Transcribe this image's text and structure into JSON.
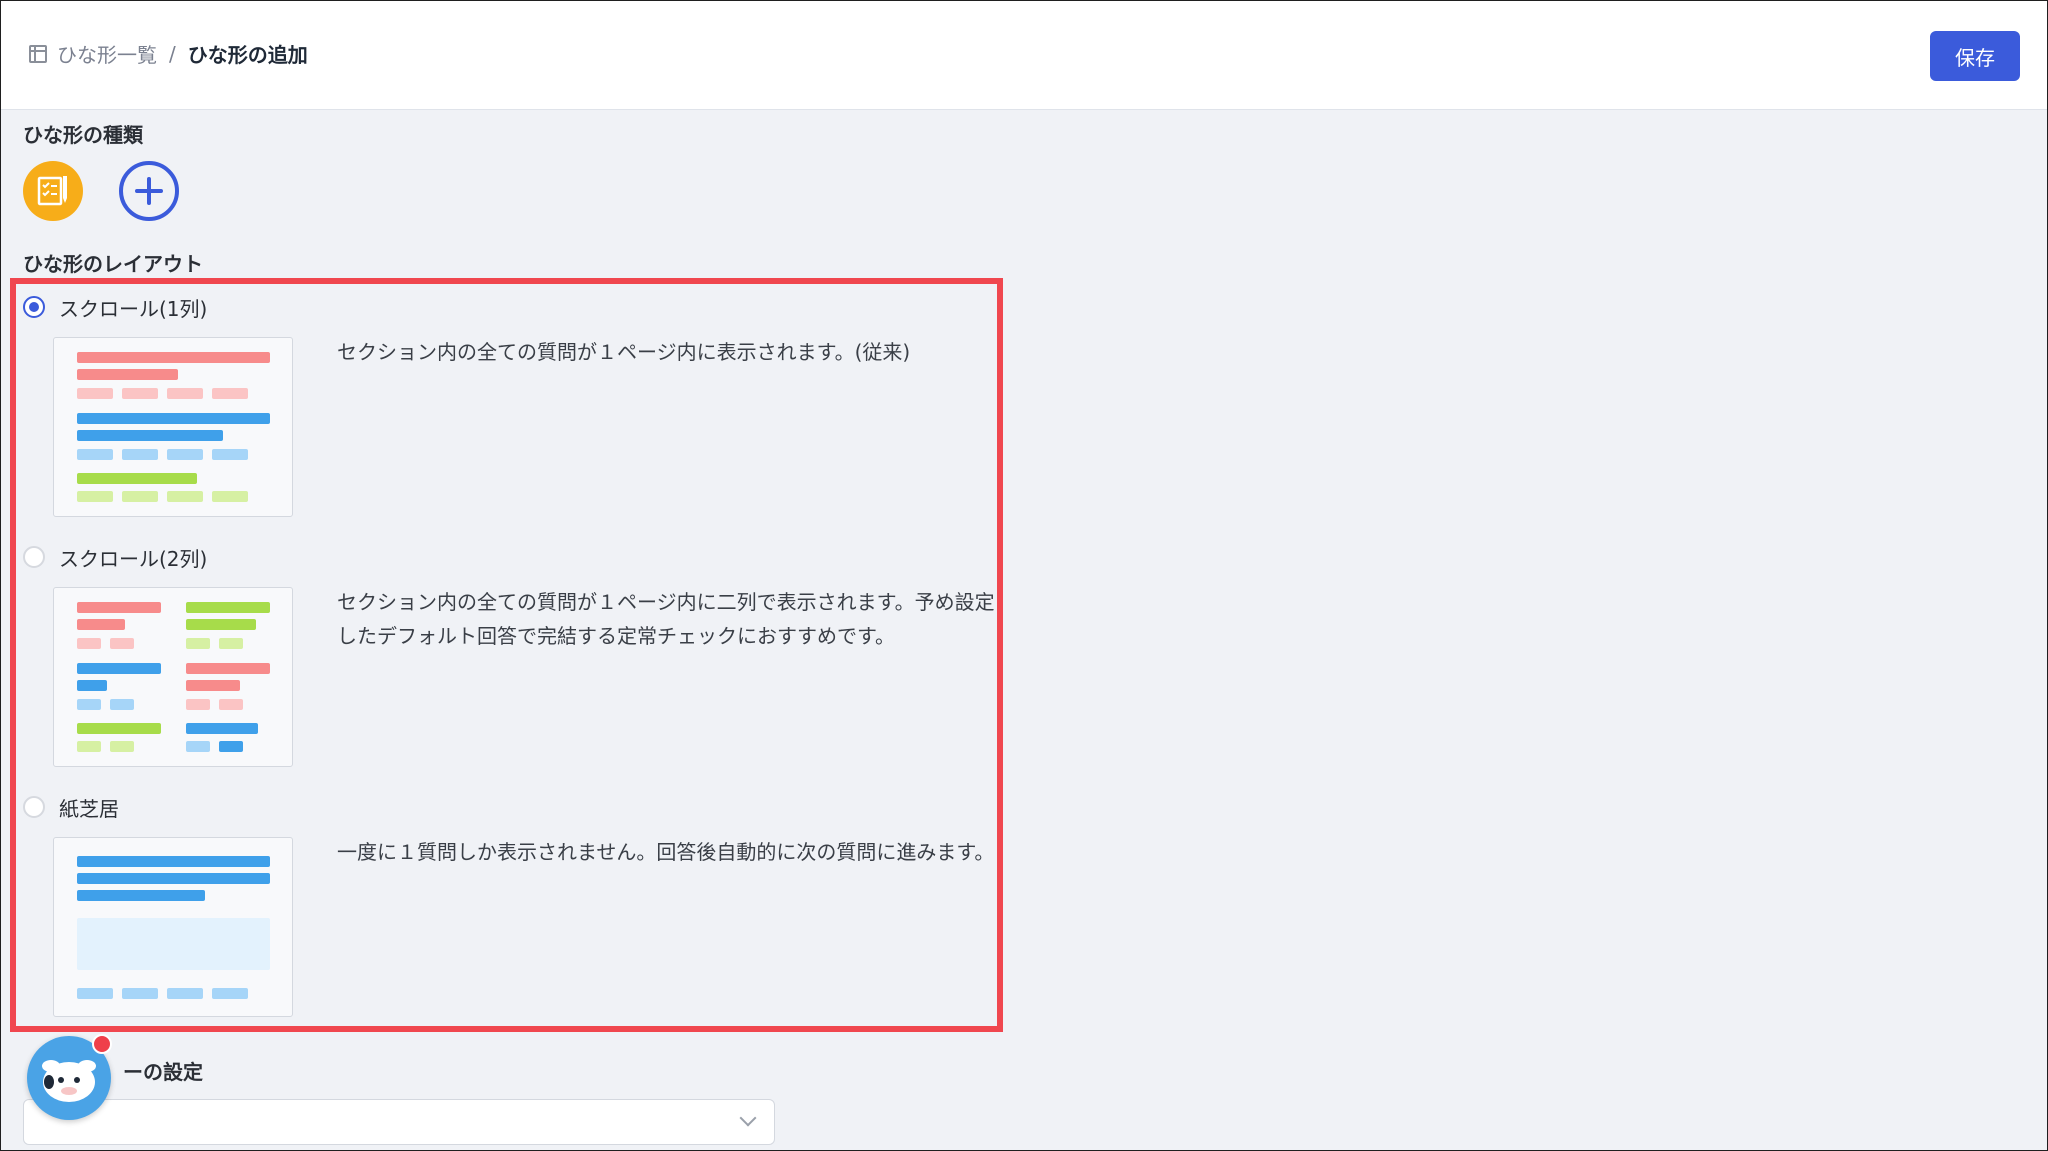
{
  "header": {
    "breadcrumb_parent": "ひな形一覧",
    "breadcrumb_separator": "/",
    "breadcrumb_current": "ひな形の追加",
    "save_label": "保存"
  },
  "template_type": {
    "title": "ひな形の種類",
    "icons": [
      "checklist-icon",
      "add-icon"
    ]
  },
  "layout": {
    "title": "ひな形のレイアウト",
    "options": [
      {
        "label": "スクロール(1列)",
        "checked": true,
        "description": "セクション内の全ての質問が１ページ内に表示されます。(従来)"
      },
      {
        "label": "スクロール(2列)",
        "checked": false,
        "description": "セクション内の全ての質問が１ページ内に二列で表示されます。予め設定したデフォルト回答で完結する定常チェックにおすすめです。"
      },
      {
        "label": "紙芝居",
        "checked": false,
        "description": "一度に１質問しか表示されません。回答後自動的に次の質問に進みます。"
      }
    ]
  },
  "cover": {
    "title_visible": "ーの設定"
  },
  "colors": {
    "accent": "#3b5bdb",
    "highlight": "#f0474f",
    "type_icon": "#f7ad19"
  }
}
